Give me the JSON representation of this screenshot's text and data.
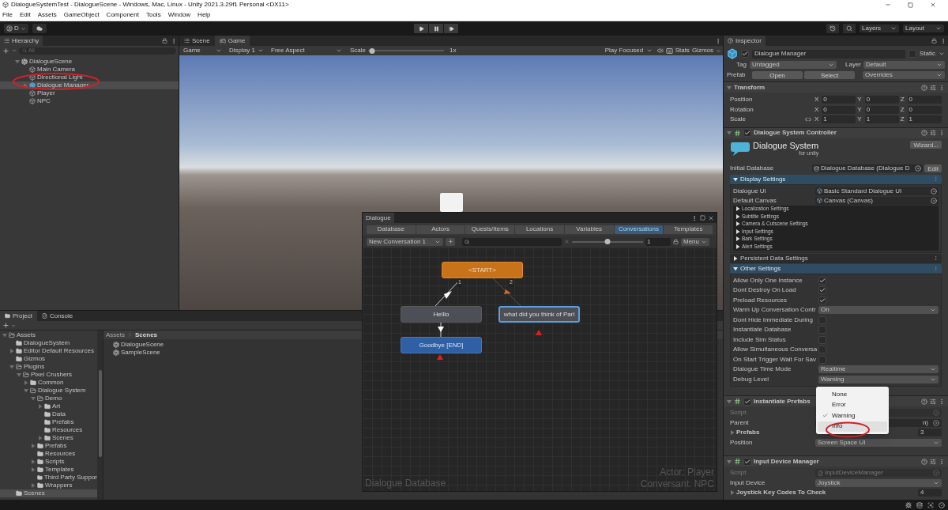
{
  "window": {
    "title": "DialogueSystemTest - DialogueScene - Windows, Mac, Linux - Unity 2021.3.29f1 Personal <DX11>"
  },
  "menu": [
    "File",
    "Edit",
    "Assets",
    "GameObject",
    "Component",
    "Tools",
    "Window",
    "Help"
  ],
  "toolbar": {
    "account": "D",
    "layers": "Layers",
    "layout": "Layout"
  },
  "hierarchy": {
    "tab": "Hierarchy",
    "search_placeholder": "All",
    "items": [
      {
        "label": "DialogueScene",
        "kind": "scene",
        "expanded": true,
        "selected": false,
        "children": [
          {
            "label": "Main Camera",
            "kind": "object",
            "selected": false
          },
          {
            "label": "Directional Light",
            "kind": "object",
            "selected": false
          },
          {
            "label": "Dialogue Manager",
            "kind": "prefab",
            "expanded": false,
            "selected": true
          },
          {
            "label": "Player",
            "kind": "object",
            "selected": false
          },
          {
            "label": "NPC",
            "kind": "object",
            "selected": false
          }
        ]
      }
    ]
  },
  "game_view": {
    "tabs": [
      {
        "label": "Scene",
        "selected": false
      },
      {
        "label": "Game",
        "selected": true
      }
    ],
    "mode": "Game",
    "display": "Display 1",
    "aspect": "Free Aspect",
    "scale_label": "Scale",
    "scale": {
      "level": 0.05
    },
    "scale_value": "1x",
    "play_mode": "Play Focused",
    "stats": "Stats",
    "gizmos": "Gizmos"
  },
  "project": {
    "tabs": [
      {
        "label": "Project",
        "selected": true
      },
      {
        "label": "Console",
        "selected": false
      }
    ],
    "tree": [
      {
        "label": "Assets",
        "expanded": true,
        "selected": false,
        "children": [
          {
            "label": "DialogueSystem",
            "selected": false
          },
          {
            "label": "Editor Default Resources",
            "expanded": false,
            "selected": false
          },
          {
            "label": "Gizmos",
            "selected": false
          },
          {
            "label": "Plugins",
            "expanded": true,
            "selected": false,
            "children": [
              {
                "label": "Pixel Crushers",
                "expanded": true,
                "selected": false,
                "children": [
                  {
                    "label": "Common",
                    "expanded": false,
                    "selected": false
                  },
                  {
                    "label": "Dialogue System",
                    "expanded": true,
                    "selected": false,
                    "children": [
                      {
                        "label": "Demo",
                        "expanded": true,
                        "selected": false,
                        "children": [
                          {
                            "label": "Art",
                            "expanded": false,
                            "selected": false
                          },
                          {
                            "label": "Data",
                            "selected": false
                          },
                          {
                            "label": "Prefabs",
                            "selected": false
                          },
                          {
                            "label": "Resources",
                            "selected": false
                          },
                          {
                            "label": "Scenes",
                            "expanded": false,
                            "selected": false
                          }
                        ]
                      },
                      {
                        "label": "Prefabs",
                        "expanded": false,
                        "selected": false
                      },
                      {
                        "label": "Resources",
                        "selected": false
                      },
                      {
                        "label": "Scripts",
                        "expanded": false,
                        "selected": false
                      },
                      {
                        "label": "Templates",
                        "expanded": false,
                        "selected": false
                      },
                      {
                        "label": "Third Party Suppor",
                        "selected": false
                      },
                      {
                        "label": "Wrappers",
                        "expanded": false,
                        "selected": false
                      }
                    ]
                  }
                ]
              }
            ]
          },
          {
            "label": "Scenes",
            "selected": true
          }
        ]
      }
    ],
    "breadcrumb": [
      "Assets",
      "Scenes"
    ],
    "files": [
      "DialogueScene",
      "SampleScene"
    ]
  },
  "dialogue_editor": {
    "title": "Dialogue",
    "tabs": [
      {
        "label": "Database",
        "selected": false
      },
      {
        "label": "Actors",
        "selected": false
      },
      {
        "label": "Quests/Items",
        "selected": false
      },
      {
        "label": "Locations",
        "selected": false
      },
      {
        "label": "Variables",
        "selected": false
      },
      {
        "label": "Conversations",
        "selected": true
      },
      {
        "label": "Templates",
        "selected": false
      }
    ],
    "conversation": "New Conversation 1",
    "zoom": {
      "level": 0.5
    },
    "zoom_value": "1",
    "menu": "Menu",
    "nodes": [
      {
        "text": "<START>",
        "kind": "start",
        "selected": false
      },
      {
        "text": "Helllo",
        "kind": "normal",
        "selected": false
      },
      {
        "text": "what did you think of Pari",
        "kind": "normal",
        "selected": true
      },
      {
        "text": "Goodbye [END]",
        "kind": "end",
        "selected": false
      }
    ],
    "link_labels": [
      "1",
      "2"
    ],
    "database_label": "Dialogue Database",
    "actor": "Actor: Player",
    "conversant": "Conversant: NPC"
  },
  "inspector": {
    "tab": "Inspector",
    "object": {
      "name": "Dialogue Manager",
      "active": true,
      "static_label": "Static",
      "static": false,
      "tag_label": "Tag",
      "tag": "Untagged",
      "layer_label": "Layer",
      "layer": "Default",
      "prefab_label": "Prefab",
      "prefab_buttons": [
        "Open",
        "Select"
      ],
      "overrides": "Overrides"
    },
    "transform": {
      "title": "Transform",
      "expanded": true,
      "rows": [
        {
          "label": "Position",
          "values": [
            {
              "axis": "X",
              "value": "0"
            },
            {
              "axis": "Y",
              "value": "0"
            },
            {
              "axis": "Z",
              "value": "0"
            }
          ]
        },
        {
          "label": "Rotation",
          "values": [
            {
              "axis": "X",
              "value": "0"
            },
            {
              "axis": "Y",
              "value": "0"
            },
            {
              "axis": "Z",
              "value": "0"
            }
          ]
        },
        {
          "label": "Scale",
          "linked": false,
          "values": [
            {
              "axis": "X",
              "value": "1"
            },
            {
              "axis": "Y",
              "value": "1"
            },
            {
              "axis": "Z",
              "value": "1"
            }
          ]
        }
      ]
    },
    "controller": {
      "title": "Dialogue System Controller",
      "enabled": true,
      "expanded": true,
      "logo_text": "Dialogue System",
      "logo_sub": "for unity",
      "wizard": "Wizard...",
      "initial_database": {
        "label": "Initial Database",
        "value": "Dialogue Database (Dialogue D",
        "button": "Edit"
      },
      "sections": [
        {
          "title": "Display Settings",
          "expanded": true,
          "rows": [
            {
              "label": "Dialogue UI",
              "value": "Basic Standard Dialogue UI"
            },
            {
              "label": "Default Canvas",
              "value": "Canvas (Canvas)"
            }
          ],
          "subsections": [
            {
              "label": "Localization Settings",
              "expanded": false
            },
            {
              "label": "Subtitle Settings",
              "expanded": false
            },
            {
              "label": "Camera & Cutscene Settings",
              "expanded": false
            },
            {
              "label": "Input Settings",
              "expanded": false
            },
            {
              "label": "Bark Settings",
              "expanded": false
            },
            {
              "label": "Alert Settings",
              "expanded": false
            }
          ]
        },
        {
          "title": "Persistent Data Settings",
          "expanded": false
        },
        {
          "title": "Other Settings",
          "expanded": true,
          "fields": [
            {
              "kind": "checkbox",
              "label": "Allow Only One Instance",
              "checked": true
            },
            {
              "kind": "checkbox",
              "label": "Dont Destroy On Load",
              "checked": true
            },
            {
              "kind": "checkbox",
              "label": "Preload Resources",
              "checked": true
            },
            {
              "kind": "dropdown",
              "label": "Warm Up Conversation Contr",
              "value": "On"
            },
            {
              "kind": "checkbox",
              "label": "Dont Hide Immediate During",
              "checked": false
            },
            {
              "kind": "checkbox",
              "label": "Instantiate Database",
              "checked": false
            },
            {
              "kind": "checkbox",
              "label": "Include Sim Status",
              "checked": false
            },
            {
              "kind": "checkbox",
              "label": "Allow Simultaneous Conversa",
              "checked": false
            },
            {
              "kind": "checkbox",
              "label": "On Start Trigger Wait For Sav",
              "checked": false
            },
            {
              "kind": "dropdown",
              "label": "Dialogue Time Mode",
              "value": "Realtime"
            },
            {
              "kind": "dropdown",
              "label": "Debug Level",
              "value": "Warning"
            }
          ]
        }
      ]
    },
    "components": [
      {
        "title": "Instantiate Prefabs",
        "enabled": true,
        "expanded": true,
        "fields": [
          {
            "kind": "script",
            "label": "Script"
          },
          {
            "kind": "object",
            "label": "Parent",
            "value": "n)"
          },
          {
            "kind": "list",
            "label": "Prefabs",
            "expanded": false,
            "value": "3"
          },
          {
            "kind": "dropdown",
            "label": "Position",
            "value": "Screen Space UI"
          }
        ]
      },
      {
        "title": "Input Device Manager",
        "enabled": true,
        "expanded": true,
        "fields": [
          {
            "kind": "script",
            "label": "Script",
            "value": "InputDeviceManager"
          },
          {
            "kind": "dropdown",
            "label": "Input Device",
            "value": "Joystick"
          },
          {
            "kind": "list",
            "label": "Joystick Key Codes To Check",
            "expanded": false,
            "value": "4"
          }
        ]
      }
    ],
    "popup": {
      "options": [
        {
          "label": "None",
          "selected": false,
          "highlighted": false
        },
        {
          "label": "Error",
          "selected": false,
          "highlighted": false
        },
        {
          "label": "Warning",
          "selected": true,
          "highlighted": false
        },
        {
          "label": "Info",
          "selected": false,
          "highlighted": true
        }
      ]
    }
  }
}
